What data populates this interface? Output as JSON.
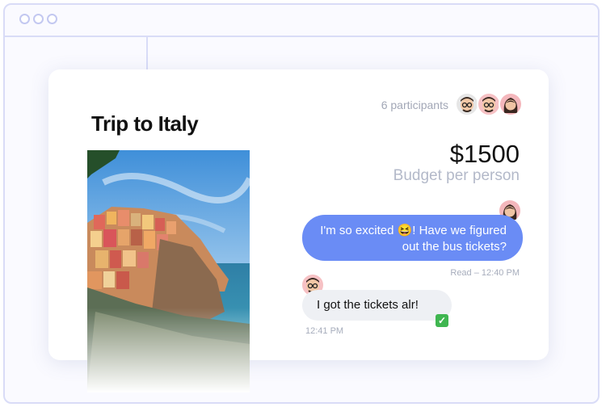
{
  "trip": {
    "title": "Trip to Italy",
    "participants_label": "6 participants",
    "budget_amount": "$1500",
    "budget_label": "Budget per person"
  },
  "messages": [
    {
      "direction": "outgoing",
      "line1": "I'm so excited 😆! Have we figured",
      "line2": "out the bus tickets?",
      "meta": "Read  – 12:40 PM",
      "avatar": "woman-avatar"
    },
    {
      "direction": "incoming",
      "text": "I got the tickets alr!",
      "time": "12:41 PM",
      "reaction": "check-mark-icon",
      "avatar": "man-glasses-avatar"
    }
  ],
  "avatars": [
    "man-glasses-avatar",
    "man-glasses-avatar",
    "woman-avatar"
  ],
  "colors": {
    "accent": "#6a8cf5",
    "frame": "#d9dcf7",
    "incoming_bubble": "#eef0f4",
    "muted_text": "#a2a7b6"
  }
}
